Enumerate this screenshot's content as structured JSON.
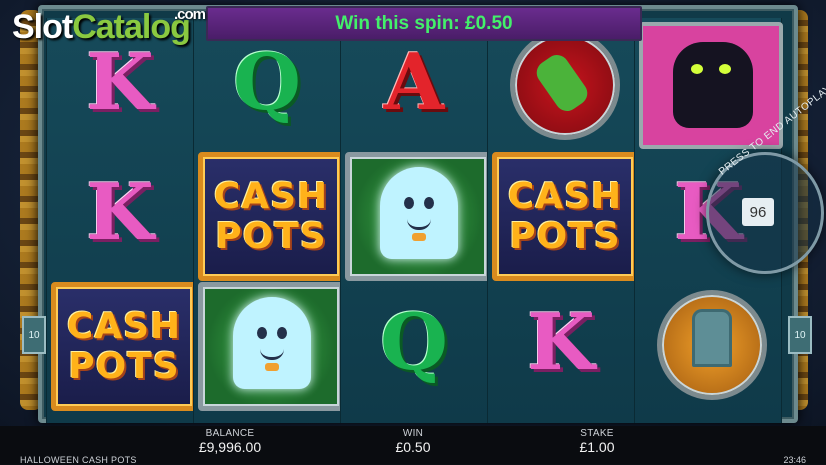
{
  "banner": {
    "win_text": "Win this spin: £0.50"
  },
  "logo": {
    "part1": "Slot",
    "part2": "Catalog",
    "suffix": ".com"
  },
  "reels": [
    [
      "K",
      "K",
      "CASH POTS"
    ],
    [
      "Q",
      "CASH POTS",
      "ghost"
    ],
    [
      "A",
      "ghost",
      "Q"
    ],
    [
      "hand",
      "CASH POTS",
      "K"
    ],
    [
      "cat",
      "K",
      "gravestone"
    ]
  ],
  "cash_pots": {
    "line1": "CASH",
    "line2": "POTS"
  },
  "autoplay": {
    "label": "PRESS TO END AUTOPLAY",
    "remaining": "96"
  },
  "side_badges": {
    "left": "10",
    "right": "10"
  },
  "footer": {
    "balance_label": "BALANCE",
    "balance_value": "£9,996.00",
    "win_label": "WIN",
    "win_value": "£0.50",
    "stake_label": "STAKE",
    "stake_value": "£1.00",
    "game_name": "HALLOWEEN CASH POTS",
    "clock": "23:46"
  },
  "colors": {
    "banner_text": "#43f06a",
    "banner_bg": "#5a2580",
    "gold_frame": "#d98b1e"
  }
}
